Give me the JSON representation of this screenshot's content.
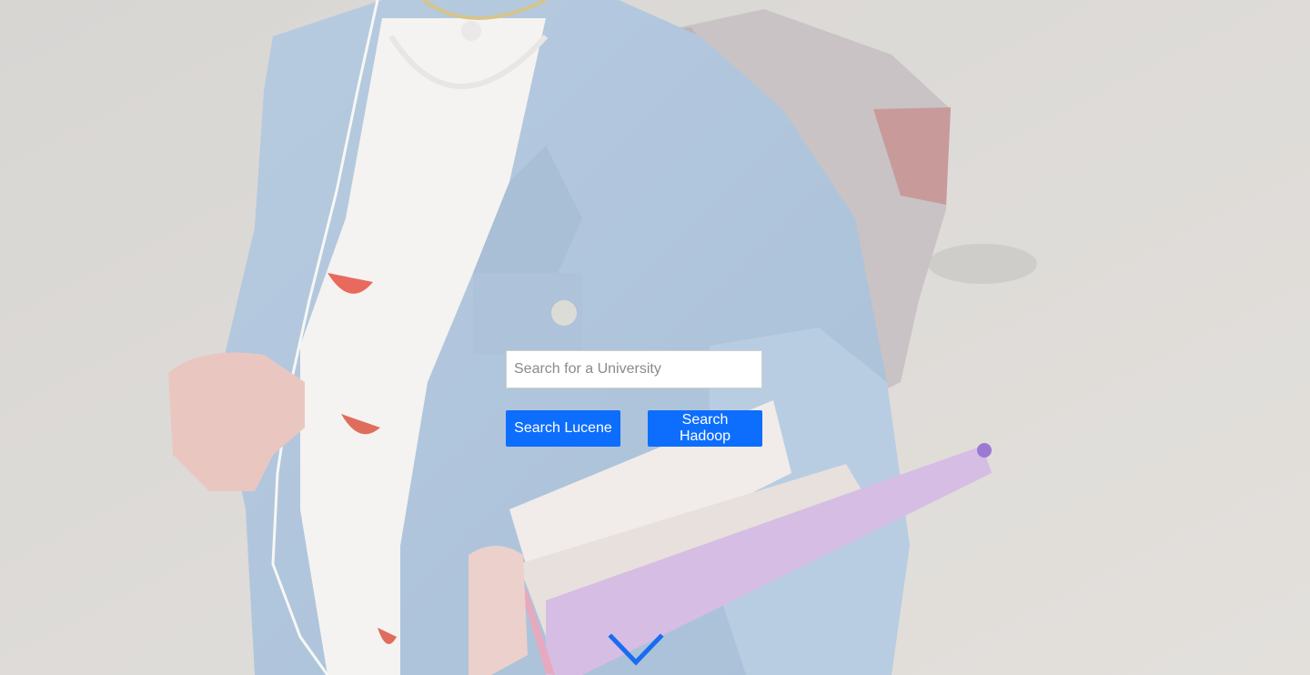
{
  "search": {
    "placeholder": "Search for a University",
    "value": ""
  },
  "buttons": {
    "lucene_label": "Search Lucene",
    "hadoop_label": "Search Hadoop"
  },
  "colors": {
    "button": "#0d6efd",
    "chevron": "#1a6cf0"
  },
  "icons": {
    "scroll": "chevron-down-icon"
  }
}
